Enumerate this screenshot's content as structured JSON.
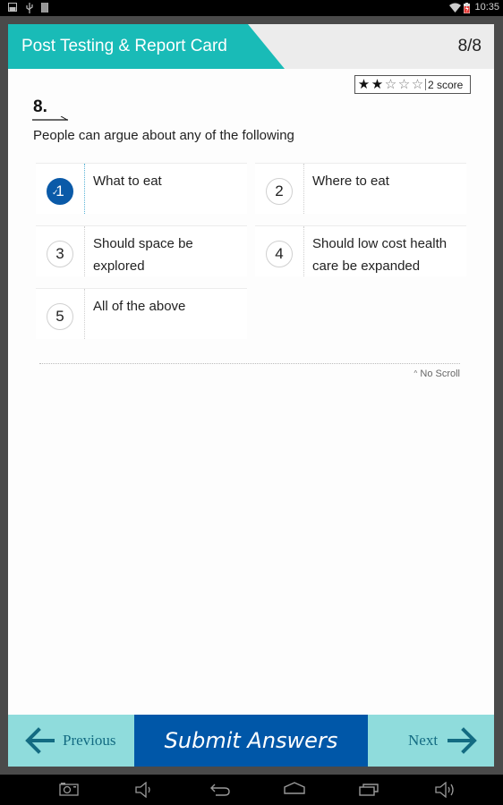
{
  "status_bar": {
    "time": "10:35",
    "left_icons": [
      "image-notification-icon",
      "usb-icon",
      "sd-card-icon"
    ],
    "right_icons": [
      "wifi-icon",
      "battery-charging-icon"
    ]
  },
  "header": {
    "title": "Post Testing & Report Card",
    "progress": "8/8",
    "accent_color": "#19bbb7"
  },
  "score": {
    "rating": 2,
    "max_rating": 5,
    "label": "2 score"
  },
  "question": {
    "number": "8.",
    "text": "People can argue about any of the following",
    "options": [
      {
        "num": "1",
        "label": "What to eat",
        "selected": true
      },
      {
        "num": "2",
        "label": "Where to eat",
        "selected": false
      },
      {
        "num": "3",
        "label": "Should space be explored",
        "selected": false
      },
      {
        "num": "4",
        "label": "Should low cost health care be expanded",
        "selected": false
      },
      {
        "num": "5",
        "label": "All of the above",
        "selected": false
      }
    ]
  },
  "scroll_hint": "No Scroll",
  "footer": {
    "previous_label": "Previous",
    "submit_label": "Submit Answers",
    "next_label": "Next",
    "submit_color": "#0057a8",
    "nav_color": "#8fdcdc"
  },
  "nav_bar": {
    "icons": [
      "screenshot-icon",
      "volume-down-icon",
      "back-icon",
      "home-icon",
      "recent-apps-icon",
      "volume-up-icon"
    ]
  }
}
